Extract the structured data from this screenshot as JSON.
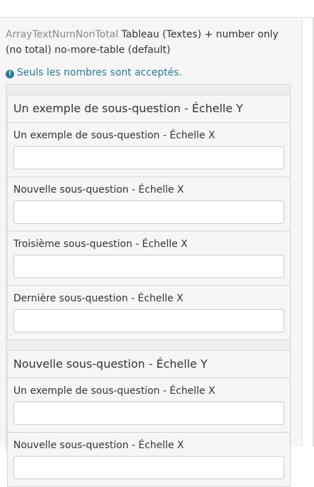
{
  "question": {
    "code": "ArrayTextNumNonTotal",
    "text": "Tableau (Textes) + number only (no total) no-more-table (default)",
    "tip": "Seuls les nombres sont acceptés."
  },
  "groups": [
    {
      "title": "Un exemple de sous-question - Échelle Y",
      "rows": [
        {
          "label": "Un exemple de sous-question - Échelle X",
          "value": ""
        },
        {
          "label": "Nouvelle sous-question - Échelle X",
          "value": ""
        },
        {
          "label": "Troisième sous-question - Échelle X",
          "value": ""
        },
        {
          "label": "Dernière sous-question - Échelle X",
          "value": ""
        }
      ]
    },
    {
      "title": "Nouvelle sous-question - Échelle Y",
      "rows": [
        {
          "label": "Un exemple de sous-question - Échelle X",
          "value": ""
        },
        {
          "label": "Nouvelle sous-question - Échelle X",
          "value": ""
        }
      ]
    }
  ]
}
